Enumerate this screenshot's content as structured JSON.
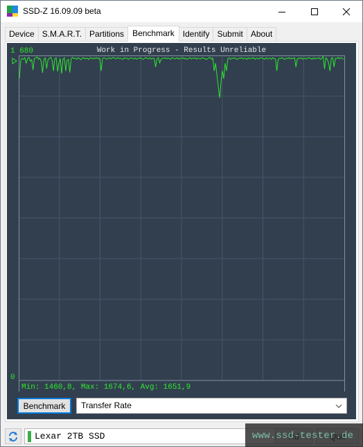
{
  "window": {
    "title": "SSD-Z 16.09.09 beta",
    "controls": {
      "minimize": "minimize-icon",
      "maximize": "maximize-icon",
      "close": "close-icon"
    }
  },
  "tabs": [
    {
      "label": "Device",
      "active": false
    },
    {
      "label": "S.M.A.R.T.",
      "active": false
    },
    {
      "label": "Partitions",
      "active": false
    },
    {
      "label": "Benchmark",
      "active": true
    },
    {
      "label": "Identify",
      "active": false
    },
    {
      "label": "Submit",
      "active": false
    },
    {
      "label": "About",
      "active": false
    }
  ],
  "benchmark": {
    "button_label": "Benchmark",
    "mode_select": {
      "value": "Transfer Rate"
    }
  },
  "footer": {
    "drive_name": "Lexar 2TB SSD",
    "drive_status_color": "#3cac47",
    "refresh_icon": "refresh-icon",
    "right_button_1": "Rd",
    "right_button_2": "Quit",
    "watermark": "www.ssd-tester.de"
  },
  "colors": {
    "chart_bg": "#323f4f",
    "line": "#2ee82e",
    "grid": "#45566a",
    "frame": "#8391a0",
    "label_green": "#2ee82e",
    "title_text": "#e6e6e6"
  },
  "chart_data": {
    "type": "line",
    "title": "Work in Progress - Results Unreliable",
    "ylabel": "",
    "xlabel": "",
    "ylim": [
      0,
      1680
    ],
    "y_top_label": "1 680",
    "y_bottom_label": "0",
    "grid": true,
    "x_divisions": 8,
    "y_divisions": 8,
    "stats_text": "Min: 1460,8, Max: 1674,6, Avg: 1651,9",
    "stats": {
      "min": 1460.8,
      "max": 1674.6,
      "avg": 1651.9
    },
    "series": [
      {
        "name": "Transfer Rate",
        "values": [
          1560,
          1655,
          1665,
          1660,
          1668,
          1640,
          1662,
          1670,
          1650,
          1658,
          1605,
          1664,
          1668,
          1672,
          1660,
          1666,
          1648,
          1590,
          1660,
          1667,
          1612,
          1658,
          1665,
          1670,
          1655,
          1600,
          1662,
          1668,
          1598,
          1640,
          1664,
          1586,
          1660,
          1668,
          1600,
          1655,
          1660,
          1592,
          1662,
          1670,
          1664,
          1666,
          1660,
          1668,
          1664,
          1658,
          1665,
          1669,
          1662,
          1666,
          1664,
          1660,
          1668,
          1666,
          1662,
          1667,
          1664,
          1669,
          1662,
          1665,
          1600,
          1662,
          1668,
          1666,
          1660,
          1664,
          1668,
          1662,
          1666,
          1670,
          1664,
          1662,
          1668,
          1664,
          1666,
          1662,
          1660,
          1668,
          1664,
          1666,
          1660,
          1665,
          1668,
          1664,
          1662,
          1667,
          1660,
          1666,
          1664,
          1668,
          1662,
          1660,
          1666,
          1669,
          1664,
          1662,
          1668,
          1660,
          1666,
          1664,
          1620,
          1662,
          1668,
          1642,
          1660,
          1666,
          1664,
          1668,
          1662,
          1666,
          1664,
          1660,
          1668,
          1666,
          1662,
          1664,
          1668,
          1660,
          1666,
          1664,
          1668,
          1662,
          1666,
          1660,
          1664,
          1668,
          1662,
          1666,
          1664,
          1668,
          1660,
          1666,
          1664,
          1662,
          1668,
          1666,
          1664,
          1660,
          1662,
          1668,
          1670,
          1660,
          1666,
          1600,
          1640,
          1580,
          1520,
          1460.8,
          1540,
          1600,
          1560,
          1640,
          1600,
          1662,
          1668,
          1660,
          1666,
          1664,
          1668,
          1662,
          1660,
          1666,
          1664,
          1668,
          1662,
          1666,
          1664,
          1660,
          1668,
          1662,
          1666,
          1664,
          1668,
          1660,
          1666,
          1664,
          1662,
          1668,
          1666,
          1664,
          1660,
          1668,
          1662,
          1664,
          1666,
          1660,
          1668,
          1664,
          1662,
          1600,
          1660,
          1666,
          1664,
          1668,
          1662,
          1660,
          1666,
          1664,
          1668,
          1662,
          1666,
          1664,
          1668,
          1620,
          1662,
          1666,
          1664,
          1668,
          1660,
          1666,
          1664,
          1662,
          1668,
          1666,
          1664,
          1660,
          1668,
          1662,
          1666,
          1664,
          1668,
          1660,
          1664,
          1674.6,
          1610,
          1668,
          1660,
          1640,
          1600,
          1666,
          1668,
          1620,
          1665,
          1664,
          1670,
          1662,
          1668,
          1666,
          1660
        ]
      }
    ]
  }
}
